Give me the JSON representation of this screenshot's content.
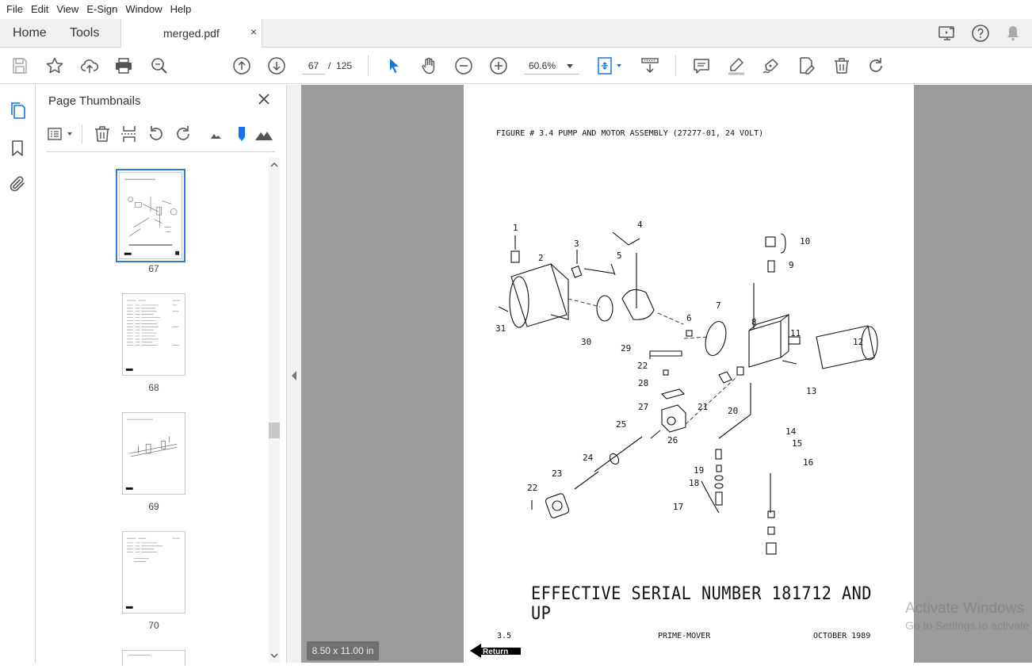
{
  "menu": [
    "File",
    "Edit",
    "View",
    "E-Sign",
    "Window",
    "Help"
  ],
  "tabs": {
    "home": "Home",
    "tools": "Tools",
    "document": "merged.pdf",
    "close": "×"
  },
  "toolbar": {
    "current_page": "67",
    "page_separator": "/",
    "total_pages": "125",
    "zoom": "60.6%"
  },
  "thumbnails": {
    "title": "Page Thumbnails",
    "pages": [
      {
        "label": "67",
        "selected": true
      },
      {
        "label": "68",
        "selected": false
      },
      {
        "label": "69",
        "selected": false
      },
      {
        "label": "70",
        "selected": false
      }
    ]
  },
  "document": {
    "figure_title": "FIGURE # 3.4 PUMP AND MOTOR ASSEMBLY (27277-01, 24 VOLT)",
    "effective": "EFFECTIVE SERIAL NUMBER 181712 AND UP",
    "footer_left": "3.5",
    "footer_mid": "PRIME-MOVER",
    "footer_right": "OCTOBER 1989",
    "return_label": "Return",
    "callouts": [
      "1",
      "2",
      "3",
      "4",
      "5",
      "6",
      "7",
      "8",
      "9",
      "10",
      "11",
      "12",
      "13",
      "14",
      "15",
      "16",
      "17",
      "18",
      "19",
      "20",
      "21",
      "22",
      "22",
      "23",
      "24",
      "25",
      "26",
      "27",
      "28",
      "29",
      "30",
      "31"
    ]
  },
  "viewer": {
    "page_size": "8.50 x 11.00 in"
  },
  "watermark": {
    "line1": "Activate Windows",
    "line2": "Go to Settings to activate"
  }
}
